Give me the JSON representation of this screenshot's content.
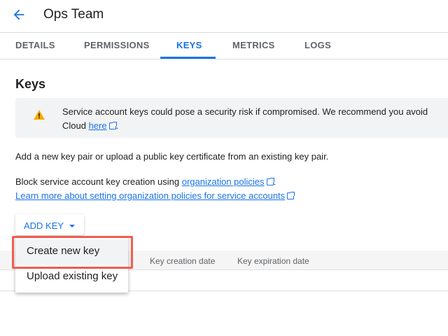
{
  "header": {
    "title": "Ops Team",
    "back_icon": "arrow-left-icon"
  },
  "tabs": [
    {
      "label": "DETAILS"
    },
    {
      "label": "PERMISSIONS"
    },
    {
      "label": "KEYS",
      "active": true
    },
    {
      "label": "METRICS"
    },
    {
      "label": "LOGS"
    }
  ],
  "section": {
    "title": "Keys"
  },
  "banner": {
    "icon": "warning-icon",
    "text1": "Service account keys could pose a security risk if compromised. We recommend you avoid",
    "text2": "Cloud ",
    "link": "here",
    "after": "."
  },
  "info": {
    "line1": "Add a new key pair or upload a public key certificate from an existing key pair.",
    "line2": "Block service account key creation using ",
    "line2_link": "organization policies",
    "line2_after": ".",
    "line3_link": "Learn more about setting organization policies for service accounts"
  },
  "add_key": {
    "label": "ADD KEY"
  },
  "menu": {
    "items": [
      "Create new key",
      "Upload existing key"
    ],
    "highlighted": "Create new key"
  },
  "table": {
    "columns": [
      "Key creation date",
      "Key expiration date"
    ]
  },
  "colors": {
    "accent": "#1a73e8",
    "highlight_box": "#f25c4f",
    "warning": "#f9ab00"
  }
}
